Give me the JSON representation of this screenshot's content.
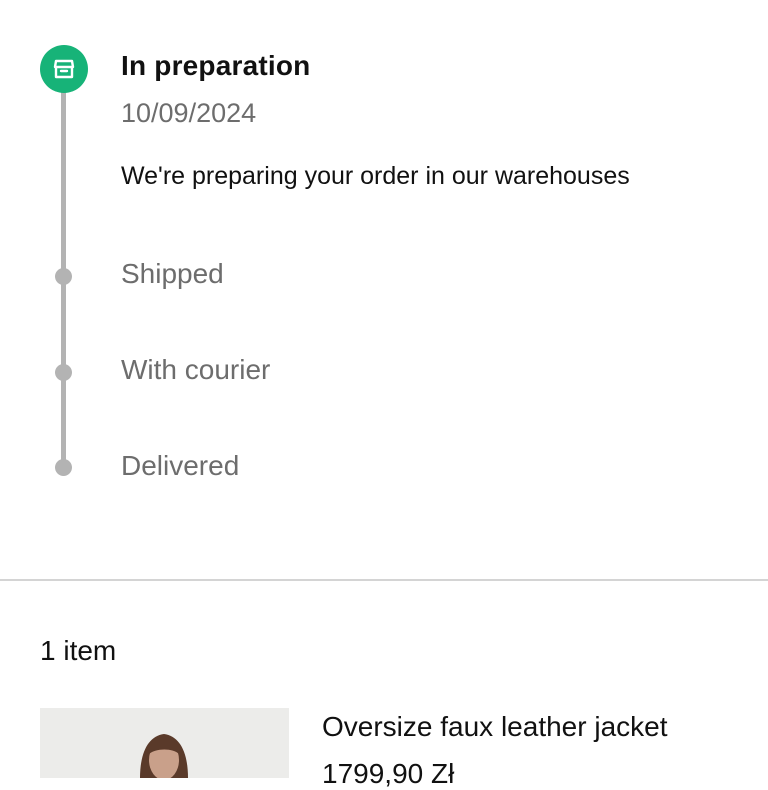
{
  "timeline": {
    "current_step": {
      "title": "In preparation",
      "date": "10/09/2024",
      "description": "We're preparing your order in our warehouses",
      "icon": "package-box-icon",
      "color": "#17b378"
    },
    "upcoming_steps": [
      {
        "label": "Shipped"
      },
      {
        "label": "With courier"
      },
      {
        "label": "Delivered"
      }
    ]
  },
  "items": {
    "count_label": "1 item",
    "products": [
      {
        "name": "Oversize faux leather jacket",
        "price": "1799,90 Zł",
        "image": "product-photo-woman-jacket"
      }
    ]
  }
}
